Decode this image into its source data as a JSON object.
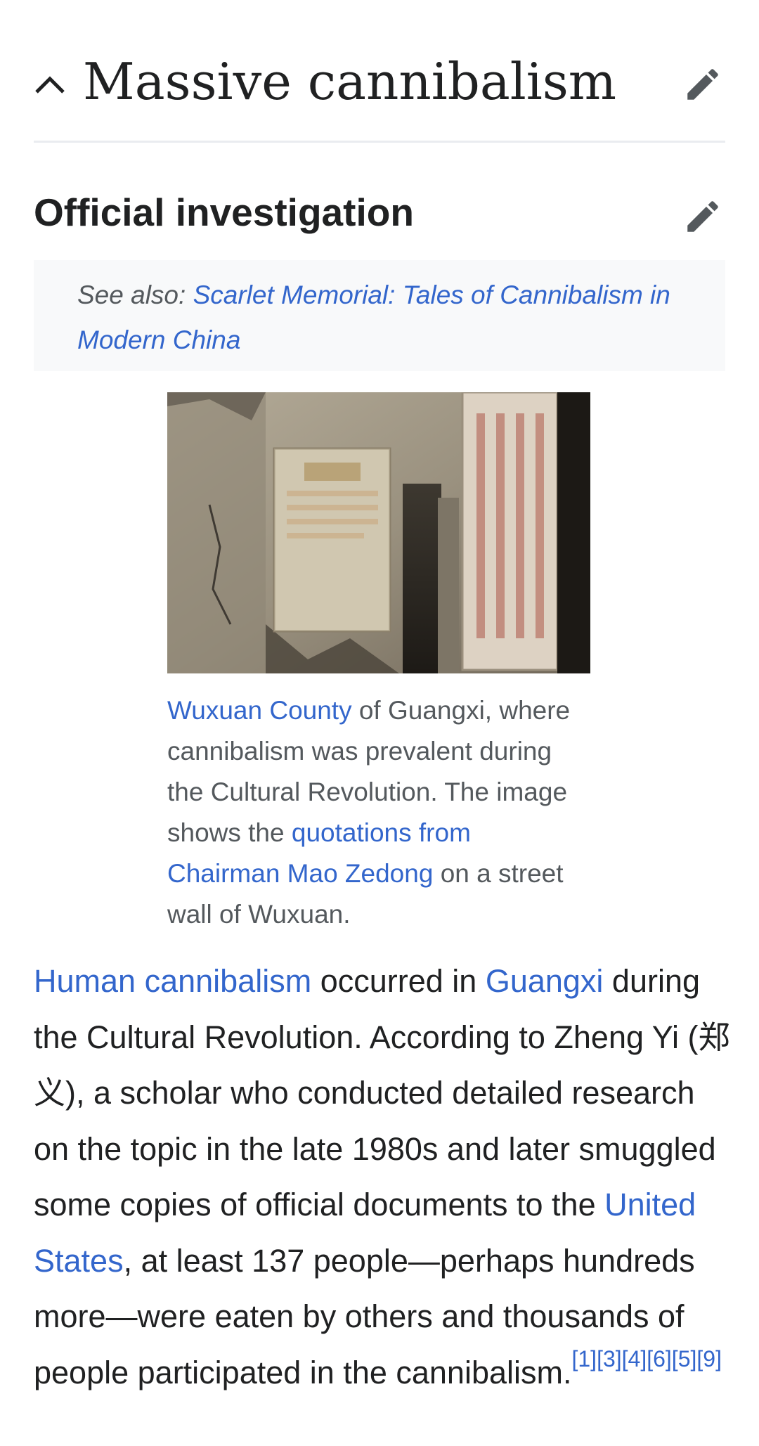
{
  "section": {
    "title": "Massive cannibalism"
  },
  "subsection": {
    "title": "Official investigation"
  },
  "hatnote": {
    "prefix": "See also: ",
    "link": "Scarlet Memorial: Tales of Cannibalism in Modern China"
  },
  "figure": {
    "caption_link1": "Wuxuan County",
    "caption_text1": " of Guangxi, where cannibalism was prevalent during the Cultural Revolution. The image shows the ",
    "caption_link2": "quotations from Chairman Mao Zedong",
    "caption_text2": " on a street wall of Wuxuan."
  },
  "paragraph": {
    "link1": "Human cannibalism",
    "text1": " occurred in ",
    "link2": "Guangxi",
    "text2": " during the Cultural Revolution. According to Zheng Yi (郑义), a scholar who conducted detailed research on the topic in the late 1980s and later smuggled some copies of official documents to the ",
    "link3": "United States",
    "text3": ", at least 137 people—perhaps hundreds more—were eaten by others and thousands of people participated in the cannibalism.",
    "refs": "[1][3][4][6][5][9]"
  },
  "icons": {
    "collapse": "chevron-up-icon",
    "edit": "pencil-icon"
  },
  "colors": {
    "link": "#3366cc",
    "text": "#202122",
    "muted": "#54595d",
    "hatnote_bg": "#f8f9fa",
    "divider": "#eaecf0"
  }
}
